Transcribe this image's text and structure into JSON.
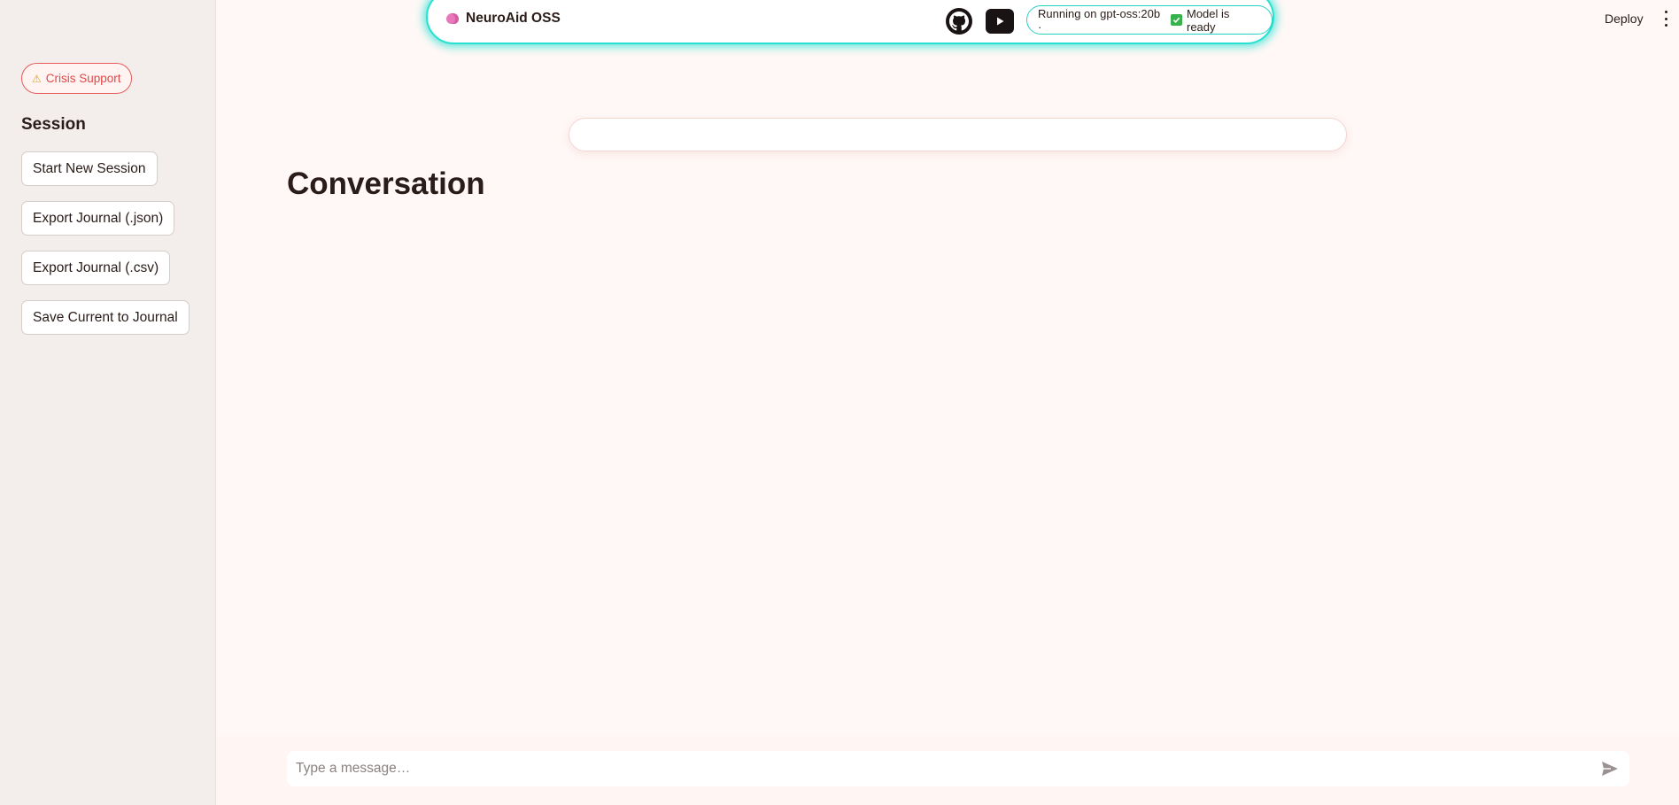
{
  "sidebar": {
    "crisis_label": "Crisis Support",
    "session_heading": "Session",
    "buttons": [
      {
        "label": "Start New Session"
      },
      {
        "label": "Export Journal (.json)"
      },
      {
        "label": "Export Journal (.csv)"
      },
      {
        "label": "Save Current to Journal"
      }
    ]
  },
  "topbar": {
    "title": "NeuroAid OSS",
    "status_prefix": "Running on gpt-oss:20b ·",
    "status_ready": "Model is ready"
  },
  "header": {
    "deploy_label": "Deploy"
  },
  "main": {
    "title": "Conversation",
    "search_value": ""
  },
  "chat": {
    "placeholder": "Type a message…"
  },
  "icons": {
    "brand": "brain-icon",
    "crisis": "warning-icon",
    "github": "github-icon",
    "youtube": "youtube-icon",
    "status": "check-icon",
    "menu": "kebab-menu-icon",
    "send": "send-icon"
  },
  "colors": {
    "accent_glow": "#27e0d2",
    "crisis_red": "#e04848",
    "ready_green": "#37b24d",
    "background": "#fff8f6",
    "sidebar_bg": "#f3eeeb"
  }
}
